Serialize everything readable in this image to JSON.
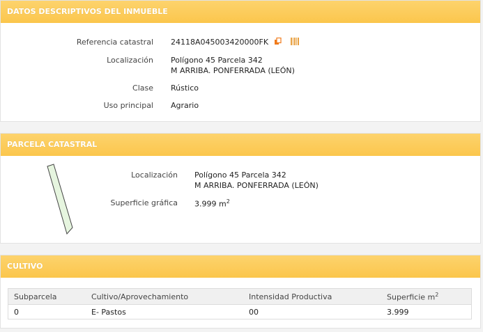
{
  "inmueble": {
    "header": "DATOS DESCRIPTIVOS DEL INMUEBLE",
    "ref_label": "Referencia catastral",
    "ref_value": "24118A045003420000FK",
    "loc_label": "Localización",
    "loc_line1": "Polígono 45 Parcela 342",
    "loc_line2": "M ARRIBA. PONFERRADA (LEÓN)",
    "clase_label": "Clase",
    "clase_value": "Rústico",
    "uso_label": "Uso principal",
    "uso_value": "Agrario",
    "icons": [
      "copy-icon",
      "barcode-icon"
    ]
  },
  "parcela": {
    "header": "PARCELA CATASTRAL",
    "loc_label": "Localización",
    "loc_line1": "Polígono 45 Parcela 342",
    "loc_line2": "M ARRIBA. PONFERRADA (LEÓN)",
    "sup_label": "Superficie gráfica",
    "sup_value": "3.999 m",
    "sup_exp": "2"
  },
  "cultivo": {
    "header": "CULTIVO",
    "columns": [
      "Subparcela",
      "Cultivo/Aprovechamiento",
      "Intensidad Productiva",
      "Superficie m"
    ],
    "col4_exp": "2",
    "rows": [
      [
        "0",
        "E- Pastos",
        "00",
        "3.999"
      ]
    ]
  },
  "colors": {
    "header_bg": "#fcc851",
    "parcel_fill": "#e6f5df",
    "copy_icon": "#f07a1a",
    "barcode_icon": "#e8a040"
  }
}
